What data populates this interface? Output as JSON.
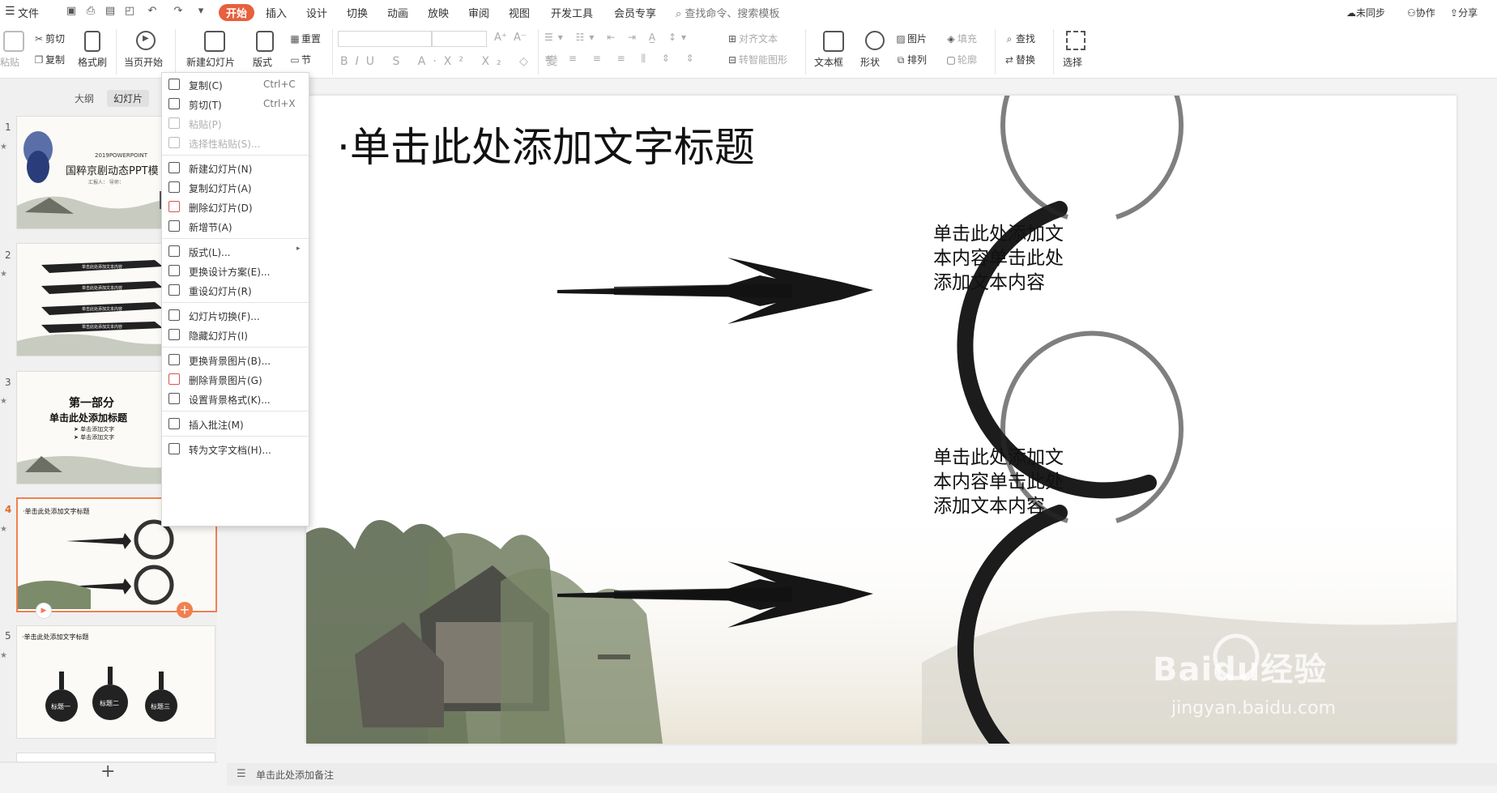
{
  "menubar": {
    "file": "文件",
    "tabs": [
      "开始",
      "插入",
      "设计",
      "切换",
      "动画",
      "放映",
      "审阅",
      "视图",
      "开发工具",
      "会员专享"
    ],
    "active_tab": "开始",
    "search": "查找命令、搜索模板",
    "right": [
      "未同步",
      "协作",
      "分享"
    ]
  },
  "ribbon": {
    "paste": "粘贴",
    "cut": "剪切",
    "copy": "复制",
    "format_painter": "格式刷",
    "from_current": "当页开始",
    "new_slide": "新建幻灯片",
    "layout": "版式",
    "section": "节",
    "reset": "重置",
    "align_text": "对齐文本",
    "smartart": "转智能图形",
    "textbox": "文本框",
    "shape": "形状",
    "picture": "图片",
    "fill": "填充",
    "arrange": "排列",
    "outline": "轮廓",
    "find": "查找",
    "replace": "替换",
    "select": "选择"
  },
  "panel": {
    "outline_tab": "大纲",
    "slides_tab": "幻灯片",
    "add": "+"
  },
  "thumbs": {
    "t1_label": "2019POWERPOINT",
    "t1_title": "国粹京剧动态PPT模",
    "t1_sub": "汇报人：   导师：",
    "t2_line": "单击此处添加文本内容",
    "t3_part": "第一部分",
    "t3_title": "单击此处添加标题",
    "t3_b1": "➤ 单击添加文字",
    "t3_b2": "➤ 单击添加文字",
    "t4_title": "·单击此处添加文字标题",
    "t5_title": "·单击此处添加文字标题",
    "t5_labels": [
      "标题一",
      "标题二",
      "标题三"
    ]
  },
  "context_menu": [
    {
      "label": "复制(C)",
      "shortcut": "Ctrl+C",
      "disabled": false
    },
    {
      "label": "剪切(T)",
      "shortcut": "Ctrl+X",
      "disabled": false
    },
    {
      "label": "粘贴(P)",
      "shortcut": "",
      "disabled": true
    },
    {
      "label": "选择性粘贴(S)...",
      "shortcut": "",
      "disabled": true
    },
    {
      "label": "新建幻灯片(N)",
      "shortcut": "",
      "disabled": false
    },
    {
      "label": "复制幻灯片(A)",
      "shortcut": "",
      "disabled": false
    },
    {
      "label": "删除幻灯片(D)",
      "shortcut": "",
      "disabled": false
    },
    {
      "label": "新增节(A)",
      "shortcut": "",
      "disabled": false
    },
    {
      "label": "版式(L)...",
      "shortcut": "",
      "disabled": false
    },
    {
      "label": "更换设计方案(E)...",
      "shortcut": "",
      "disabled": false
    },
    {
      "label": "重设幻灯片(R)",
      "shortcut": "",
      "disabled": false
    },
    {
      "label": "幻灯片切换(F)...",
      "shortcut": "",
      "disabled": false
    },
    {
      "label": "隐藏幻灯片(I)",
      "shortcut": "",
      "disabled": false
    },
    {
      "label": "更换背景图片(B)...",
      "shortcut": "",
      "disabled": false
    },
    {
      "label": "删除背景图片(G)",
      "shortcut": "",
      "disabled": false
    },
    {
      "label": "设置背景格式(K)...",
      "shortcut": "",
      "disabled": false
    },
    {
      "label": "插入批注(M)",
      "shortcut": "",
      "disabled": false
    },
    {
      "label": "转为文字文档(H)...",
      "shortcut": "",
      "disabled": false
    }
  ],
  "slide": {
    "title": "·单击此处添加文字标题",
    "text1": "单击此处添加文本内容单击此处添加文本内容",
    "text2": "单击此处添加文本内容单击此处添加文本内容",
    "watermark_brand": "Baidu经验",
    "watermark_url": "jingyan.baidu.com"
  },
  "notes": "单击此处添加备注",
  "colors": {
    "accent": "#e8603c",
    "selection": "#f08050"
  }
}
